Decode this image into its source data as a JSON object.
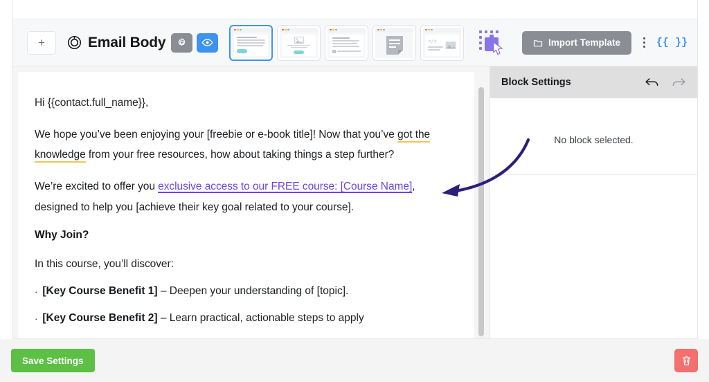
{
  "toolbar": {
    "add_label": "+",
    "doc_title": "Email Body",
    "logo_icon": "target-rings-icon",
    "gear_icon": "gear-icon",
    "eye_icon": "eye-icon",
    "block_icon": "puzzle-block-cursor-icon",
    "import_label": "Import Template",
    "folder_icon": "folder-icon",
    "kebab_icon": "vertical-dots-icon",
    "merge_tag_label": "{{ }}",
    "templates": [
      {
        "name": "text-layout-template",
        "selected": true
      },
      {
        "name": "image-text-template",
        "selected": false
      },
      {
        "name": "two-column-template",
        "selected": false
      },
      {
        "name": "document-template",
        "selected": false
      },
      {
        "name": "code-image-template",
        "selected": false
      }
    ]
  },
  "email": {
    "greeting": "Hi {{contact.full_name}},",
    "para1_pre": "We hope you’ve been enjoying your [freebie or e-book title]! Now that you’ve ",
    "para1_highlight": "got the knowledge",
    "para1_post": " from your free resources, how about taking things a step further?",
    "para2_pre": "We’re excited to offer you ",
    "para2_link": "exclusive access to our FREE course: [Course Name]",
    "para2_post": ", designed to help you [achieve their key goal related to your course].",
    "heading_why_join": "Why Join?",
    "para3": "In this course, you’ll discover:",
    "bullets": [
      {
        "marker": "·",
        "bold": "[Key Course Benefit 1]",
        "rest": " – Deepen your understanding of [topic]."
      },
      {
        "marker": "·",
        "bold": "[Key Course Benefit 2]",
        "rest": " – Learn practical, actionable steps to apply"
      }
    ]
  },
  "panel": {
    "title": "Block Settings",
    "undo_icon": "undo-arrow-icon",
    "redo_icon": "redo-arrow-icon",
    "empty_message": "No block selected."
  },
  "footer": {
    "save_label": "Save Settings",
    "delete_icon": "trash-icon"
  },
  "annotation": {
    "name": "callout-arrow",
    "color": "#2c1f7a"
  },
  "colors": {
    "accent_blue": "#3c93f2",
    "link_purple": "#6f42e5",
    "highlight_yellow": "#f0c758",
    "save_green": "#5cc044",
    "delete_red": "#f2706e",
    "gray_button": "#8a8d93"
  }
}
